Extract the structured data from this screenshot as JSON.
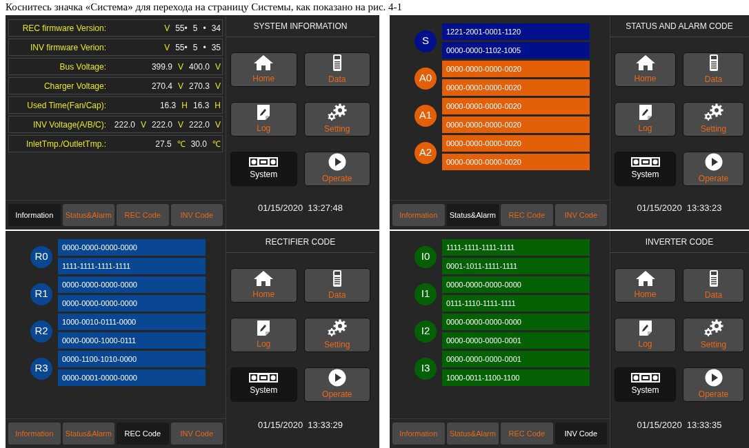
{
  "caption": "Коснитесь значка «Система» для перехода на страницу Системы, как показано на рис. 4-1",
  "screens": [
    {
      "kind": "info",
      "title": "SYSTEM INFORMATION",
      "datetime": "01/15/2020  13:27:48",
      "rows": [
        {
          "label": "REC firmware Version:",
          "parts": [
            {
              "text": "V",
              "kind": "unit"
            },
            {
              "text": "55•",
              "kind": "value"
            },
            {
              "text": "5",
              "kind": "value"
            },
            {
              "text": "•",
              "kind": "value"
            },
            {
              "text": "34",
              "kind": "value"
            }
          ]
        },
        {
          "label": "INV firmware Verion:",
          "parts": [
            {
              "text": "V",
              "kind": "unit"
            },
            {
              "text": "55•",
              "kind": "value"
            },
            {
              "text": "5",
              "kind": "value"
            },
            {
              "text": "•",
              "kind": "value"
            },
            {
              "text": "35",
              "kind": "value"
            }
          ]
        },
        {
          "label": "Bus Voltage:",
          "parts": [
            {
              "text": "399.9",
              "kind": "value"
            },
            {
              "text": "V",
              "kind": "unit"
            },
            {
              "text": "400.0",
              "kind": "value"
            },
            {
              "text": "V",
              "kind": "unit"
            }
          ]
        },
        {
          "label": "Charger Voltage:",
          "parts": [
            {
              "text": "270.4",
              "kind": "value"
            },
            {
              "text": "V",
              "kind": "unit"
            },
            {
              "text": "270.3",
              "kind": "value"
            },
            {
              "text": "V",
              "kind": "unit"
            }
          ]
        },
        {
          "label": "Used Time(Fan/Cap):",
          "parts": [
            {
              "text": "16.3",
              "kind": "value"
            },
            {
              "text": "H",
              "kind": "unit"
            },
            {
              "text": "16.3",
              "kind": "value"
            },
            {
              "text": "H",
              "kind": "unit"
            }
          ]
        },
        {
          "label": "INV Voltage(A/B/C):",
          "parts": [
            {
              "text": "222.0",
              "kind": "value"
            },
            {
              "text": "V",
              "kind": "unit"
            },
            {
              "text": "222.0",
              "kind": "value"
            },
            {
              "text": "V",
              "kind": "unit"
            },
            {
              "text": "222.0",
              "kind": "value"
            },
            {
              "text": "V",
              "kind": "unit"
            }
          ]
        },
        {
          "label": "InletTmp./OutletTmp.:",
          "parts": [
            {
              "text": "27.5",
              "kind": "value"
            },
            {
              "text": "℃",
              "kind": "unit"
            },
            {
              "text": "30.0",
              "kind": "value"
            },
            {
              "text": "℃",
              "kind": "unit"
            }
          ]
        }
      ],
      "tabs": [
        {
          "label": "Information",
          "selected": true
        },
        {
          "label": "Status&Alarm",
          "selected": false
        },
        {
          "label": "REC Code",
          "selected": false
        },
        {
          "label": "INV Code",
          "selected": false
        }
      ],
      "nav": [
        {
          "label": "Home",
          "kind": "home",
          "selected": false
        },
        {
          "label": "Data",
          "kind": "data",
          "selected": false
        },
        {
          "label": "Log",
          "kind": "log",
          "selected": false
        },
        {
          "label": "Setting",
          "kind": "setting",
          "selected": false
        },
        {
          "label": "System",
          "kind": "system",
          "selected": true
        },
        {
          "label": "Operate",
          "kind": "operate",
          "selected": false
        }
      ]
    },
    {
      "kind": "codes",
      "title": "STATUS AND ALARM CODE",
      "datetime": "01/15/2020  13:33:23",
      "groups": [
        {
          "badge": "S",
          "color": "#000f8a",
          "codes": [
            "1221-2001-0001-1120",
            "0000-0000-1102-1005"
          ]
        },
        {
          "badge": "A0",
          "color": "#e35f08",
          "codes": [
            "0000-0000-0000-0020",
            "0000-0000-0000-0020"
          ]
        },
        {
          "badge": "A1",
          "color": "#e35f08",
          "codes": [
            "0000-0000-0000-0020",
            "0000-0000-0000-0020"
          ]
        },
        {
          "badge": "A2",
          "color": "#e35f08",
          "codes": [
            "0000-0000-0000-0020",
            "0000-0000-0000-0020"
          ]
        }
      ],
      "tabs": [
        {
          "label": "Information",
          "selected": false
        },
        {
          "label": "Status&Alarm",
          "selected": true
        },
        {
          "label": "REC Code",
          "selected": false
        },
        {
          "label": "INV Code",
          "selected": false
        }
      ],
      "nav": [
        {
          "label": "Home",
          "kind": "home",
          "selected": false
        },
        {
          "label": "Data",
          "kind": "data",
          "selected": false
        },
        {
          "label": "Log",
          "kind": "log",
          "selected": false
        },
        {
          "label": "Setting",
          "kind": "setting",
          "selected": false
        },
        {
          "label": "System",
          "kind": "system",
          "selected": true
        },
        {
          "label": "Operate",
          "kind": "operate",
          "selected": false
        }
      ]
    },
    {
      "kind": "codes",
      "title": "RECTIFIER CODE",
      "datetime": "01/15/2020  13:33:29",
      "groups": [
        {
          "badge": "R0",
          "color": "#0a4793",
          "codes": [
            "0000-0000-0000-0000",
            "1111-1111-1111-1111"
          ]
        },
        {
          "badge": "R1",
          "color": "#0a4793",
          "codes": [
            "0000-0000-0000-0000",
            "0000-0000-0000-0000"
          ]
        },
        {
          "badge": "R2",
          "color": "#0a4793",
          "codes": [
            "1000-0010-0111-0000",
            "0000-0000-1000-0111"
          ]
        },
        {
          "badge": "R3",
          "color": "#0a4793",
          "codes": [
            "0000-1100-1010-0000",
            "0000-0001-0000-0000"
          ]
        }
      ],
      "tabs": [
        {
          "label": "Information",
          "selected": false
        },
        {
          "label": "Status&Alarm",
          "selected": false
        },
        {
          "label": "REC Code",
          "selected": true
        },
        {
          "label": "INV Code",
          "selected": false
        }
      ],
      "nav": [
        {
          "label": "Home",
          "kind": "home",
          "selected": false
        },
        {
          "label": "Data",
          "kind": "data",
          "selected": false
        },
        {
          "label": "Log",
          "kind": "log",
          "selected": false
        },
        {
          "label": "Setting",
          "kind": "setting",
          "selected": false
        },
        {
          "label": "System",
          "kind": "system",
          "selected": true
        },
        {
          "label": "Operate",
          "kind": "operate",
          "selected": false
        }
      ]
    },
    {
      "kind": "codes",
      "title": "INVERTER CODE",
      "datetime": "01/15/2020  13:33:35",
      "groups": [
        {
          "badge": "I0",
          "color": "#036103",
          "codes": [
            "1111-1111-1111-1111",
            "0001-1011-1111-1111"
          ]
        },
        {
          "badge": "I1",
          "color": "#036103",
          "codes": [
            "0000-0000-0000-0000",
            "0111-1110-1111-1111"
          ]
        },
        {
          "badge": "I2",
          "color": "#036103",
          "codes": [
            "0000-0000-0000-0000",
            "0000-0000-0000-0001"
          ]
        },
        {
          "badge": "I3",
          "color": "#036103",
          "codes": [
            "0000-0000-0000-0001",
            "1000-0011-1100-1100"
          ]
        }
      ],
      "tabs": [
        {
          "label": "Information",
          "selected": false
        },
        {
          "label": "Status&Alarm",
          "selected": false
        },
        {
          "label": "REC Code",
          "selected": false
        },
        {
          "label": "INV Code",
          "selected": true
        }
      ],
      "nav": [
        {
          "label": "Home",
          "kind": "home",
          "selected": false
        },
        {
          "label": "Data",
          "kind": "data",
          "selected": false
        },
        {
          "label": "Log",
          "kind": "log",
          "selected": false
        },
        {
          "label": "Setting",
          "kind": "setting",
          "selected": false
        },
        {
          "label": "System",
          "kind": "system",
          "selected": true
        },
        {
          "label": "Operate",
          "kind": "operate",
          "selected": false
        }
      ]
    }
  ]
}
